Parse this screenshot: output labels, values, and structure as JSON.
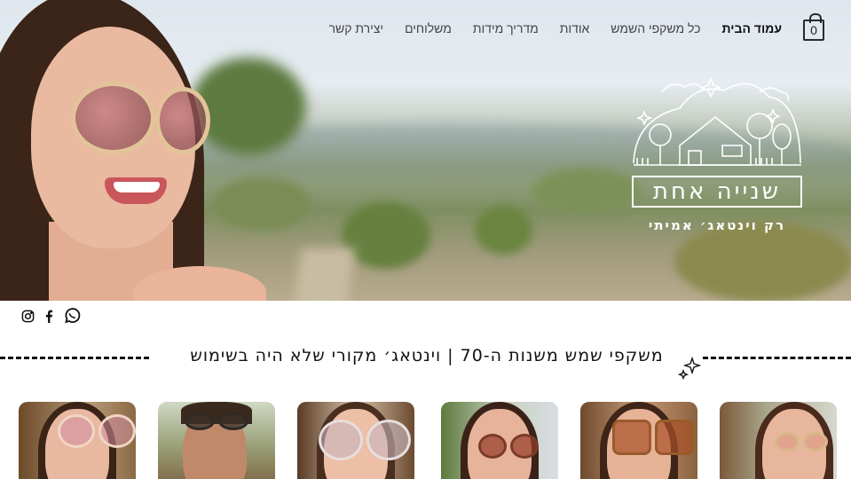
{
  "nav": {
    "cart_count": "0",
    "items": [
      {
        "label": "עמוד הבית",
        "active": true
      },
      {
        "label": "כל משקפי השמש",
        "active": false
      },
      {
        "label": "אודות",
        "active": false
      },
      {
        "label": "מדריך מידות",
        "active": false
      },
      {
        "label": "משלוחים",
        "active": false
      },
      {
        "label": "יצירת קשר",
        "active": false
      }
    ]
  },
  "logo": {
    "title": "שנייה אחת",
    "subtitle": "רק וינטאג׳ אמיתי"
  },
  "social": [
    "instagram-icon",
    "facebook-icon",
    "whatsapp-icon"
  ],
  "tagline": "משקפי שמש משנות ה-70   |   וינטאג׳ מקורי שלא היה בשימוש",
  "colors": {
    "text": "#111111",
    "nav_text": "#444444",
    "logo": "#ffffff"
  },
  "products": [
    {
      "name": "product-card-1"
    },
    {
      "name": "product-card-2"
    },
    {
      "name": "product-card-3"
    },
    {
      "name": "product-card-4"
    },
    {
      "name": "product-card-5"
    },
    {
      "name": "product-card-6"
    }
  ]
}
